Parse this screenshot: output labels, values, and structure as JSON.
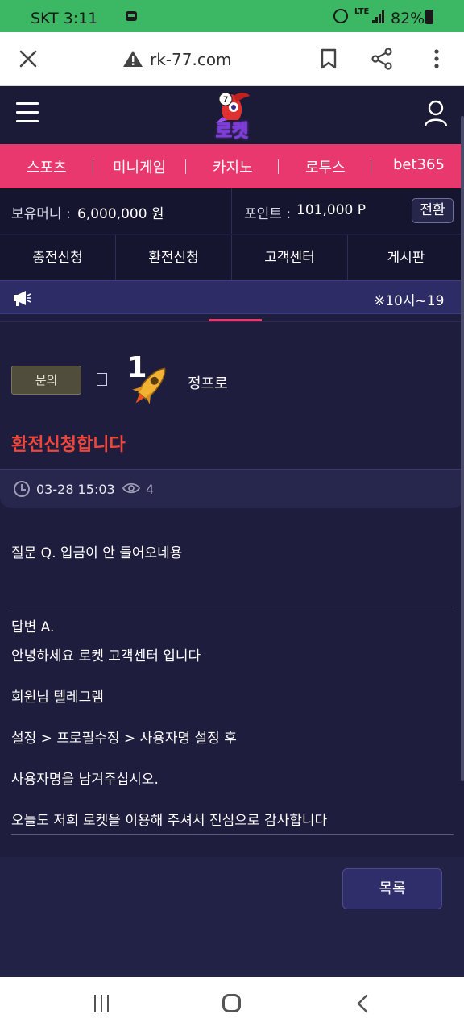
{
  "status_bar": {
    "carrier_time": "SKT 3:11",
    "network": "LTE",
    "battery": "82%"
  },
  "browser": {
    "url": "rk-77.com"
  },
  "site": {
    "logo_text": "로켓"
  },
  "category_nav": [
    "스포츠",
    "미니게임",
    "카지노",
    "로투스",
    "bet365"
  ],
  "account": {
    "money_label": "보유머니 :",
    "money_value": "6,000,000 원",
    "point_label": "포인트 :",
    "point_value": "101,000 P",
    "convert_label": "전환"
  },
  "action_menu": [
    "충전신청",
    "환전신청",
    "고객센터",
    "게시판"
  ],
  "notice": {
    "text": "※10시~19"
  },
  "post": {
    "category": "문의",
    "rank": "1",
    "author": "정프로",
    "title": "환전신청합니다",
    "date": "03-28 15:03",
    "views": "4",
    "question": "질문 Q. 입금이 안 들어오네용",
    "answer_lines": [
      "답변 A.",
      "안녕하세요 로켓 고객센터 입니다",
      "회원님 텔레그램",
      "설정 > 프로필수정 > 사용자명 설정 후",
      "사용자명을 남겨주십시오.",
      "오늘도 저희 로켓을 이용해 주셔서 진심으로 감사합니다"
    ]
  },
  "list_button": "목록",
  "colors": {
    "accent_pink": "#e8386e",
    "title_red": "#f0463a",
    "page_bg": "#1e1d3d",
    "status_green": "#3cb763"
  }
}
